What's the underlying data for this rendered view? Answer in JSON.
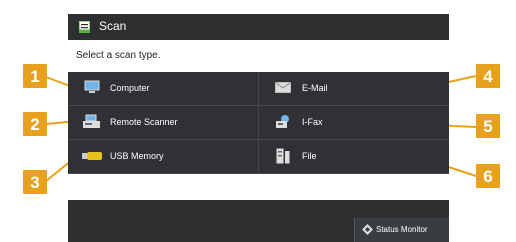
{
  "window": {
    "title": "Scan",
    "icon": "scan-icon"
  },
  "prompt": "Select a scan type.",
  "options": [
    {
      "label": "Computer",
      "icon": "computer-icon"
    },
    {
      "label": "E-Mail",
      "icon": "email-icon"
    },
    {
      "label": "Remote Scanner",
      "icon": "remote-scanner-icon"
    },
    {
      "label": "I-Fax",
      "icon": "ifax-icon"
    },
    {
      "label": "USB Memory",
      "icon": "usb-memory-icon"
    },
    {
      "label": "File",
      "icon": "file-icon"
    }
  ],
  "status_monitor": {
    "label": "Status Monitor",
    "icon": "status-monitor-icon"
  },
  "callouts": [
    "1",
    "2",
    "3",
    "4",
    "5",
    "6"
  ],
  "colors": {
    "callout": "#e8a11c",
    "panel": "#2d2f31",
    "text": "#ffffff"
  }
}
